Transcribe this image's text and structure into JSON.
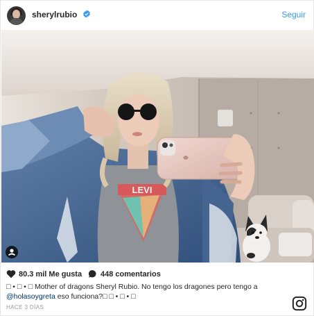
{
  "post": {
    "username": "sherylrubio",
    "follow_label": "Seguir",
    "likes": "80.3 mil Me gusta",
    "comments": "448 comentarios",
    "caption_line1": "□ • □ • □ Mother of dragons Sheryl Rubio. No tengo los dragones pero tengo a",
    "caption_mention": "@holasoygreta",
    "caption_line2_rest": " eso funciona?□ □ • □ • □",
    "timestamp": "HACE 3 DÍAS"
  },
  "photo": {
    "shirt_text": "LEVI"
  },
  "icons": {
    "verified": "verified-badge-icon",
    "heart": "heart-icon",
    "comment": "comment-bubble-icon",
    "tag": "user-tag-icon",
    "brand": "instagram-logo-icon"
  },
  "colors": {
    "link_blue": "#3897f0",
    "verified_blue": "#3897f0",
    "mention": "#003569",
    "muted": "#999999"
  }
}
